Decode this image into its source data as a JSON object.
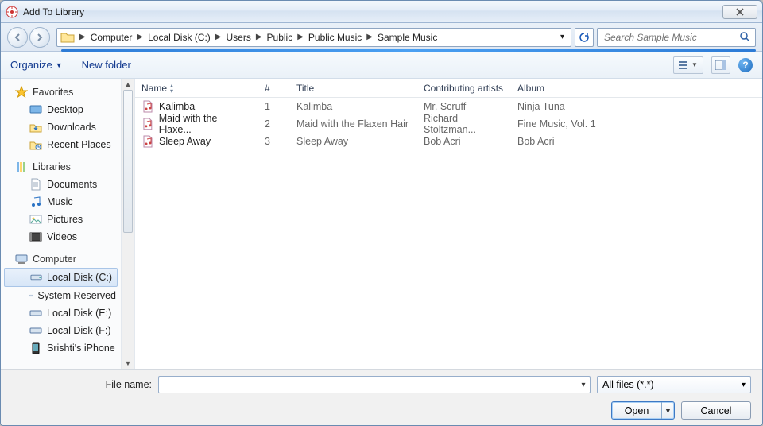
{
  "window": {
    "title": "Add To Library"
  },
  "nav": {
    "back_enabled": false,
    "forward_enabled": false,
    "breadcrumb": [
      "Computer",
      "Local Disk (C:)",
      "Users",
      "Public",
      "Public Music",
      "Sample Music"
    ],
    "search_placeholder": "Search Sample Music"
  },
  "toolbar": {
    "organize": "Organize",
    "new_folder": "New folder"
  },
  "tree": {
    "favorites": {
      "label": "Favorites",
      "items": [
        "Desktop",
        "Downloads",
        "Recent Places"
      ]
    },
    "libraries": {
      "label": "Libraries",
      "items": [
        "Documents",
        "Music",
        "Pictures",
        "Videos"
      ]
    },
    "computer": {
      "label": "Computer",
      "items": [
        "Local Disk (C:)",
        "System Reserved",
        "Local Disk (E:)",
        "Local Disk (F:)",
        "Srishti's iPhone"
      ],
      "selected_index": 0
    }
  },
  "columns": {
    "name": "Name",
    "num": "#",
    "title": "Title",
    "artist": "Contributing artists",
    "album": "Album"
  },
  "files": [
    {
      "name": "Kalimba",
      "num": "1",
      "title": "Kalimba",
      "artist": "Mr. Scruff",
      "album": "Ninja Tuna"
    },
    {
      "name": "Maid with the Flaxe...",
      "num": "2",
      "title": "Maid with the Flaxen Hair",
      "artist": "Richard Stoltzman...",
      "album": "Fine Music, Vol. 1"
    },
    {
      "name": "Sleep Away",
      "num": "3",
      "title": "Sleep Away",
      "artist": "Bob Acri",
      "album": "Bob Acri"
    }
  ],
  "footer": {
    "filename_label": "File name:",
    "filename_value": "",
    "filter": "All files (*.*)",
    "open": "Open",
    "cancel": "Cancel"
  }
}
